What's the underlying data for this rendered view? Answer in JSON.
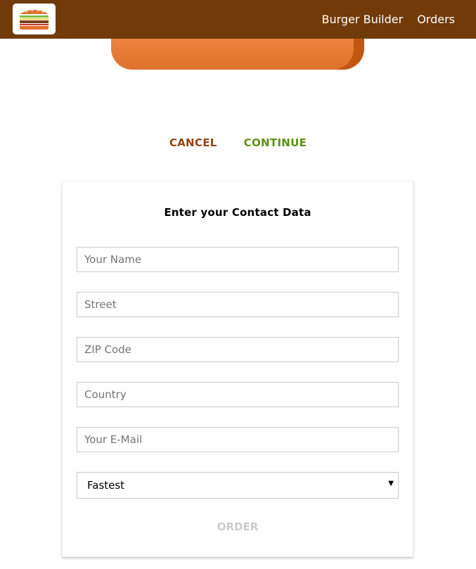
{
  "toolbar": {
    "logo_icon": "burger-logo-icon",
    "nav": [
      {
        "label": "Burger Builder"
      },
      {
        "label": "Orders"
      }
    ]
  },
  "summary_actions": {
    "cancel_label": "CANCEL",
    "continue_label": "CONTINUE",
    "colors": {
      "cancel": "#944317",
      "continue": "#5C9210"
    }
  },
  "contact_form": {
    "title": "Enter your Contact Data",
    "fields": [
      {
        "placeholder": "Your Name",
        "value": ""
      },
      {
        "placeholder": "Street",
        "value": ""
      },
      {
        "placeholder": "ZIP Code",
        "value": ""
      },
      {
        "placeholder": "Country",
        "value": ""
      },
      {
        "placeholder": "Your E-Mail",
        "value": ""
      }
    ],
    "delivery_method": {
      "selected": "Fastest"
    },
    "order_label": "ORDER"
  },
  "colors": {
    "toolbar": "#703B09",
    "bun": "#e0722b"
  }
}
